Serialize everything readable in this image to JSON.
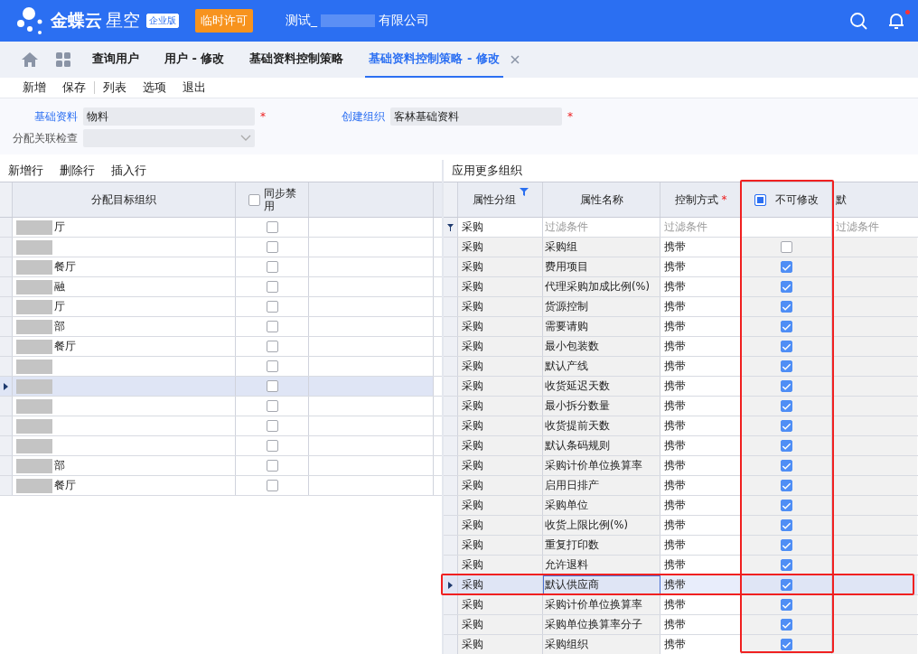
{
  "header": {
    "brand": "金蝶云",
    "product": "星空",
    "edition": "企业版",
    "license_badge": "临时许可",
    "company_prefix": "测试_",
    "company_suffix": "有限公司",
    "notification_dot": true
  },
  "tabs": [
    {
      "label": "查询用户",
      "selected": false
    },
    {
      "label": "用户 - 修改",
      "selected": false
    },
    {
      "label": "基础资料控制策略",
      "selected": false
    },
    {
      "label": "基础资料控制策略 - 修改",
      "selected": true
    }
  ],
  "toolbar": [
    "新增",
    "保存",
    "列表",
    "选项",
    "退出"
  ],
  "form": {
    "base_data": {
      "label": "基础资料",
      "value": "物料",
      "mark": "*"
    },
    "create_org": {
      "label": "创建组织",
      "value": "客林基础资料",
      "mark": "*"
    },
    "check": {
      "label": "分配关联检查"
    }
  },
  "left_grid": {
    "actions": [
      "新增行",
      "删除行",
      "插入行"
    ],
    "columns": [
      "分配目标组织",
      "同步禁用"
    ],
    "header_checked": false,
    "rows": [
      {
        "fragment": "厅",
        "checked": false,
        "selected": false
      },
      {
        "checked": false,
        "selected": false
      },
      {
        "fragment": "餐厅",
        "checked": false,
        "selected": false
      },
      {
        "fragment": "融",
        "checked": false,
        "selected": false
      },
      {
        "fragment": "厅",
        "checked": false,
        "selected": false
      },
      {
        "fragment": "部",
        "checked": false,
        "selected": false
      },
      {
        "fragment": "餐厅",
        "checked": false,
        "selected": false
      },
      {
        "checked": false,
        "selected": false
      },
      {
        "checked": false,
        "selected": true
      },
      {
        "checked": false,
        "selected": false
      },
      {
        "checked": false,
        "selected": false
      },
      {
        "checked": false,
        "selected": false
      },
      {
        "fragment": "部",
        "checked": false,
        "selected": false
      },
      {
        "fragment": "餐厅",
        "checked": false,
        "selected": false
      }
    ]
  },
  "right_grid": {
    "action": "应用更多组织",
    "columns": [
      {
        "label": "属性分组"
      },
      {
        "label": "属性名称"
      },
      {
        "label": "控制方式",
        "mark": "*"
      },
      {
        "label": "不可修改"
      },
      {
        "label": "默"
      }
    ],
    "header_indeterminate": true,
    "filter": {
      "group": "采购",
      "name_placeholder": "过滤条件",
      "control_placeholder": "过滤条件",
      "default_placeholder": "过滤条件"
    },
    "rows": [
      {
        "group": "采购",
        "name": "采购组",
        "control": "携带",
        "locked": false,
        "selected": false
      },
      {
        "group": "采购",
        "name": "费用项目",
        "control": "携带",
        "locked": true,
        "selected": false
      },
      {
        "group": "采购",
        "name": "代理采购加成比例(%)",
        "control": "携带",
        "locked": true,
        "selected": false
      },
      {
        "group": "采购",
        "name": "货源控制",
        "control": "携带",
        "locked": true,
        "selected": false
      },
      {
        "group": "采购",
        "name": "需要请购",
        "control": "携带",
        "locked": true,
        "selected": false
      },
      {
        "group": "采购",
        "name": "最小包装数",
        "control": "携带",
        "locked": true,
        "selected": false
      },
      {
        "group": "采购",
        "name": "默认产线",
        "control": "携带",
        "locked": true,
        "selected": false
      },
      {
        "group": "采购",
        "name": "收货延迟天数",
        "control": "携带",
        "locked": true,
        "selected": false
      },
      {
        "group": "采购",
        "name": "最小拆分数量",
        "control": "携带",
        "locked": true,
        "selected": false
      },
      {
        "group": "采购",
        "name": "收货提前天数",
        "control": "携带",
        "locked": true,
        "selected": false
      },
      {
        "group": "采购",
        "name": "默认条码规则",
        "control": "携带",
        "locked": true,
        "selected": false
      },
      {
        "group": "采购",
        "name": "采购计价单位换算率",
        "control": "携带",
        "locked": true,
        "selected": false
      },
      {
        "group": "采购",
        "name": "启用日排产",
        "control": "携带",
        "locked": true,
        "selected": false
      },
      {
        "group": "采购",
        "name": "采购单位",
        "control": "携带",
        "locked": true,
        "selected": false
      },
      {
        "group": "采购",
        "name": "收货上限比例(%)",
        "control": "携带",
        "locked": true,
        "selected": false
      },
      {
        "group": "采购",
        "name": "重复打印数",
        "control": "携带",
        "locked": true,
        "selected": false
      },
      {
        "group": "采购",
        "name": "允许退料",
        "control": "携带",
        "locked": true,
        "selected": false
      },
      {
        "group": "采购",
        "name": "默认供应商",
        "control": "携带",
        "locked": true,
        "selected": true
      },
      {
        "group": "采购",
        "name": "采购计价单位换算率",
        "control": "携带",
        "locked": true,
        "selected": false
      },
      {
        "group": "采购",
        "name": "采购单位换算率分子",
        "control": "携带",
        "locked": true,
        "selected": false
      },
      {
        "group": "采购",
        "name": "采购组织",
        "control": "携带",
        "locked": true,
        "selected": false
      }
    ]
  },
  "annotations": {
    "column_frame": true,
    "row_frame": true
  }
}
